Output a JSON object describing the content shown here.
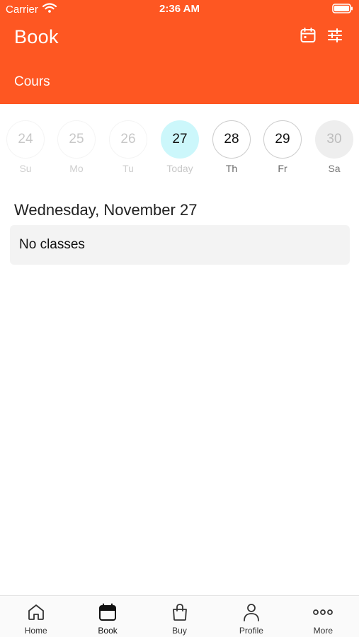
{
  "status_bar": {
    "carrier": "Carrier",
    "time": "2:36 AM"
  },
  "header": {
    "title": "Book",
    "subtitle": "Cours",
    "background_color": "#fe5722",
    "actions": [
      {
        "icon": "calendar-icon"
      },
      {
        "icon": "filter-sliders-icon"
      }
    ]
  },
  "week": {
    "days": [
      {
        "number": "24",
        "label": "Su",
        "state": "past"
      },
      {
        "number": "25",
        "label": "Mo",
        "state": "past"
      },
      {
        "number": "26",
        "label": "Tu",
        "state": "past"
      },
      {
        "number": "27",
        "label": "Today",
        "state": "today"
      },
      {
        "number": "28",
        "label": "Th",
        "state": "future"
      },
      {
        "number": "29",
        "label": "Fr",
        "state": "future"
      },
      {
        "number": "30",
        "label": "Sa",
        "state": "disabled"
      }
    ],
    "today_color": "#ccf7fb"
  },
  "schedule": {
    "date_heading": "Wednesday, November 27",
    "empty_message": "No classes"
  },
  "tab_bar": {
    "tabs": [
      {
        "label": "Home",
        "icon": "home-icon",
        "active": false
      },
      {
        "label": "Book",
        "icon": "calendar-icon",
        "active": true
      },
      {
        "label": "Buy",
        "icon": "shopping-bag-icon",
        "active": false
      },
      {
        "label": "Profile",
        "icon": "person-icon",
        "active": false
      },
      {
        "label": "More",
        "icon": "more-dots-icon",
        "active": false
      }
    ]
  }
}
